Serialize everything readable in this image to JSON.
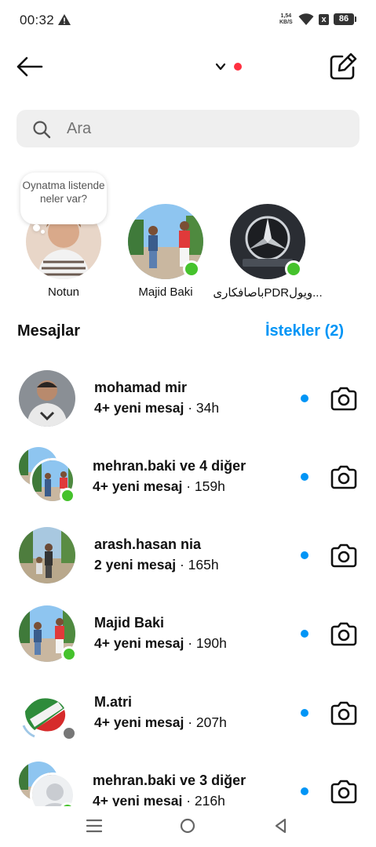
{
  "status_bar": {
    "time": "00:32",
    "net_speed_value": "1,54",
    "net_speed_unit": "KB/S",
    "battery": "86",
    "sim_label": "x",
    "icons": [
      "warning-icon",
      "wifi-icon",
      "no-sim-icon",
      "battery-icon"
    ]
  },
  "header": {
    "icons": [
      "back-arrow-icon",
      "chevron-down-icon",
      "compose-icon"
    ],
    "notification_dot_color": "#ff3040"
  },
  "search": {
    "placeholder": "Ara",
    "value": ""
  },
  "notes": {
    "bubble_text": "Oynatma listende neler var?",
    "items": [
      {
        "label": "Notun"
      },
      {
        "label": "Majid Baki",
        "online": true
      },
      {
        "label": "باصافکاریPDRویول...",
        "online": true
      }
    ]
  },
  "messages_section": {
    "title": "Mesajlar",
    "requests_label": "İstekler (2)"
  },
  "threads": [
    {
      "name": "mohamad mir",
      "count": "4+ yeni mesaj",
      "time": "· 34h",
      "unread": true,
      "online": false
    },
    {
      "name": "mehran.baki ve 4 diğer",
      "count": "4+ yeni mesaj",
      "time": "· 159h",
      "unread": true,
      "online": true
    },
    {
      "name": "arash.hasan nia",
      "count": "2 yeni mesaj",
      "time": "· 165h",
      "unread": true,
      "online": false
    },
    {
      "name": "Majid Baki",
      "count": "4+ yeni mesaj",
      "time": "· 190h",
      "unread": true,
      "online": true
    },
    {
      "name": "M.atri",
      "count": "4+ yeni mesaj",
      "time": "· 207h",
      "unread": true,
      "online": false
    },
    {
      "name": "mehran.baki ve 3 diğer",
      "count": "4+ yeni mesaj",
      "time": "· 216h",
      "unread": true,
      "online": true
    }
  ],
  "colors": {
    "accent": "#0095f6",
    "online": "#45c22c",
    "search_bg": "#efefef"
  },
  "nav_bar": {
    "icons": [
      "menu-icon",
      "home-circle-icon",
      "back-triangle-icon"
    ]
  }
}
